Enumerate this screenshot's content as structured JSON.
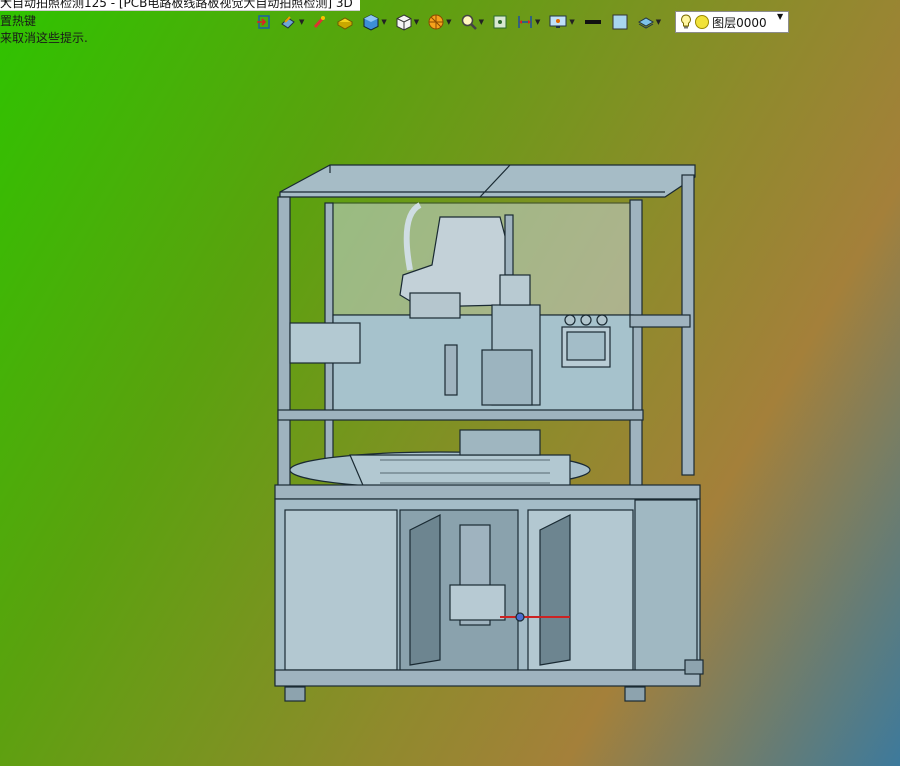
{
  "window": {
    "title_fragment": "大自动拍照检测125 - [PCB电路板线路板视觉大自动拍照检测] 3D"
  },
  "hint": {
    "line1": "置热键",
    "line2": "来取消这些提示."
  },
  "toolbar": {
    "icons": [
      "exit-sketch-icon",
      "edit-part-icon",
      "highlight-icon",
      "3d-sketch-icon",
      "solid-view-icon",
      "box-view-icon",
      "section-view-icon",
      "zoom-icon",
      "view-orient-icon",
      "dimension-icon",
      "display-settings-icon",
      "line-color-swatch-icon",
      "fill-color-swatch-icon",
      "layer-shape-icon"
    ],
    "colors": {
      "line_swatch": "#111111",
      "fill_swatch": "#a9d6ef"
    }
  },
  "layer": {
    "name": "图层0000"
  },
  "model": {
    "description_colors": {
      "frame": "#9fb3bf",
      "panel": "#a6c2cc",
      "edge": "#1a2a33",
      "glass": "#c8d4dc"
    }
  }
}
